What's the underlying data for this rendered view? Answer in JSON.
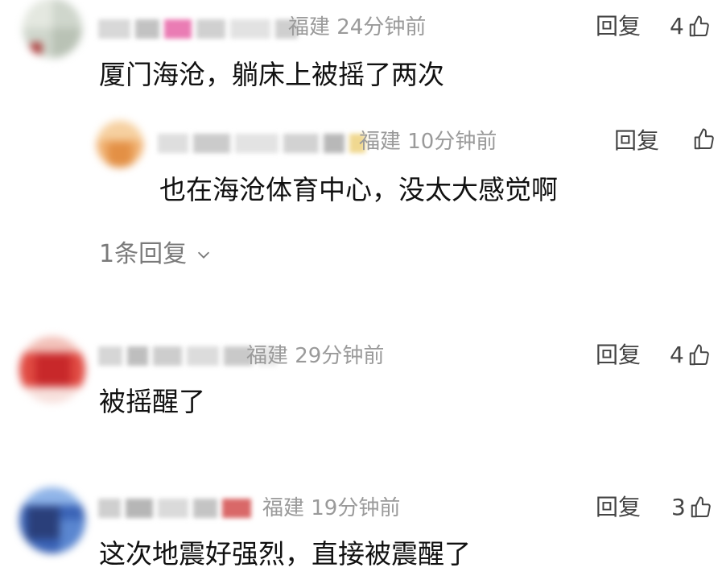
{
  "comments": [
    {
      "location_time": "福建 24分钟前",
      "reply_label": "回复",
      "likes": "4",
      "text": "厦门海沧，躺床上被摇了两次",
      "replies": [
        {
          "location_time": "福建 10分钟前",
          "reply_label": "回复",
          "text": "也在海沧体育中心，没太大感觉啊"
        }
      ],
      "more_replies": "1条回复"
    },
    {
      "location_time": "福建 29分钟前",
      "reply_label": "回复",
      "likes": "4",
      "text": "被摇醒了"
    },
    {
      "location_time": "福建 19分钟前",
      "reply_label": "回复",
      "likes": "3",
      "text": "这次地震好强烈，直接被震醒了"
    }
  ],
  "icons": {
    "like": "thumbs-up-icon",
    "expand": "chevron-down-icon"
  },
  "colors": {
    "meta": "#9a9a9a",
    "text": "#111111",
    "more": "#7a7a7a"
  }
}
